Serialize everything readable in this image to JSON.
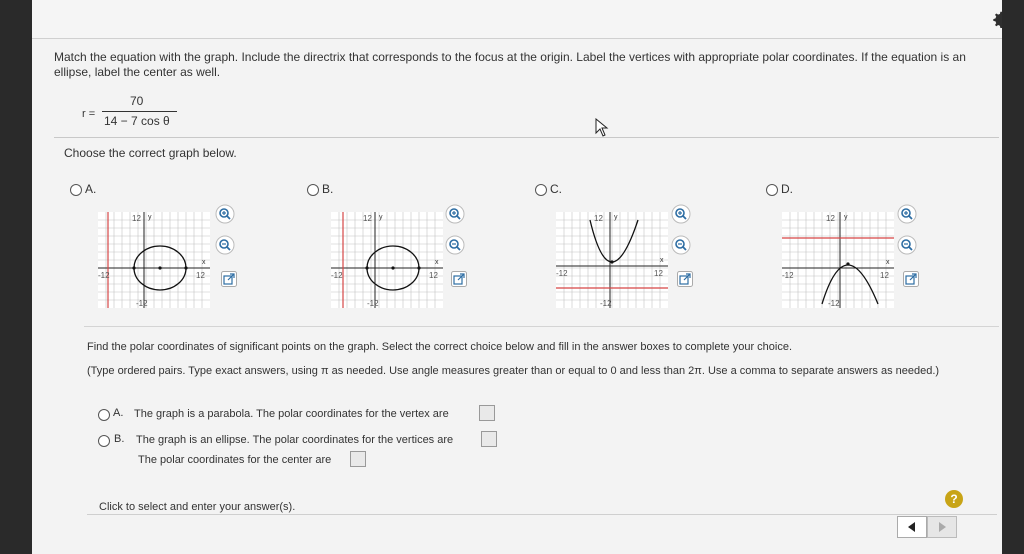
{
  "question": "Match the equation with the graph. Include the directrix that corresponds to the focus at the origin. Label the vertices with appropriate polar coordinates. If the equation is an ellipse, label the center as well.",
  "equation": {
    "lhs": "r =",
    "numerator": "70",
    "denominator": "14 − 7 cos θ"
  },
  "choose_prompt": "Choose the correct graph below.",
  "graph_options": [
    {
      "letter": "A.",
      "shape": "ellipse",
      "tick_top": "12",
      "tick_left": "-12",
      "tick_right": "12",
      "tick_bottom": "-12",
      "axis_y": "y",
      "axis_x": "x"
    },
    {
      "letter": "B.",
      "shape": "ellipse",
      "tick_top": "12",
      "tick_left": "-12",
      "tick_right": "12",
      "tick_bottom": "-12",
      "axis_y": "y",
      "axis_x": "x"
    },
    {
      "letter": "C.",
      "shape": "parabola-up",
      "tick_top": "12",
      "tick_left": "-12",
      "tick_right": "12",
      "tick_bottom": "-12",
      "axis_y": "y",
      "axis_x": "x"
    },
    {
      "letter": "D.",
      "shape": "parabola-down",
      "tick_top": "12",
      "tick_left": "-12",
      "tick_right": "12",
      "tick_bottom": "-12",
      "axis_y": "y",
      "axis_x": "x"
    }
  ],
  "find_prompt": "Find the polar coordinates of significant points on the graph. Select the correct choice below and fill in the answer boxes to complete your choice.",
  "type_note": "(Type ordered pairs. Type exact answers, using π as needed. Use angle measures greater than or equal to 0 and less than 2π. Use a comma to separate answers as needed.)",
  "answer_choices": {
    "a_letter": "A.",
    "a_text": "The graph is a parabola. The polar coordinates for the vertex are",
    "b_letter": "B.",
    "b_text": "The graph is an ellipse. The polar coordinates for the vertices are",
    "b_center_text": "The polar coordinates for the center are"
  },
  "footer": {
    "status": "Click to select and enter your answer(s).",
    "help_label": "?"
  },
  "icons": {
    "settings": "gear-icon",
    "zoom_in": "zoom-in-icon",
    "zoom_out": "zoom-out-icon",
    "open": "external-link-icon"
  },
  "colors": {
    "accent": "#2d6da3",
    "directrix": "#d64545",
    "grid": "#bfbfbf"
  }
}
